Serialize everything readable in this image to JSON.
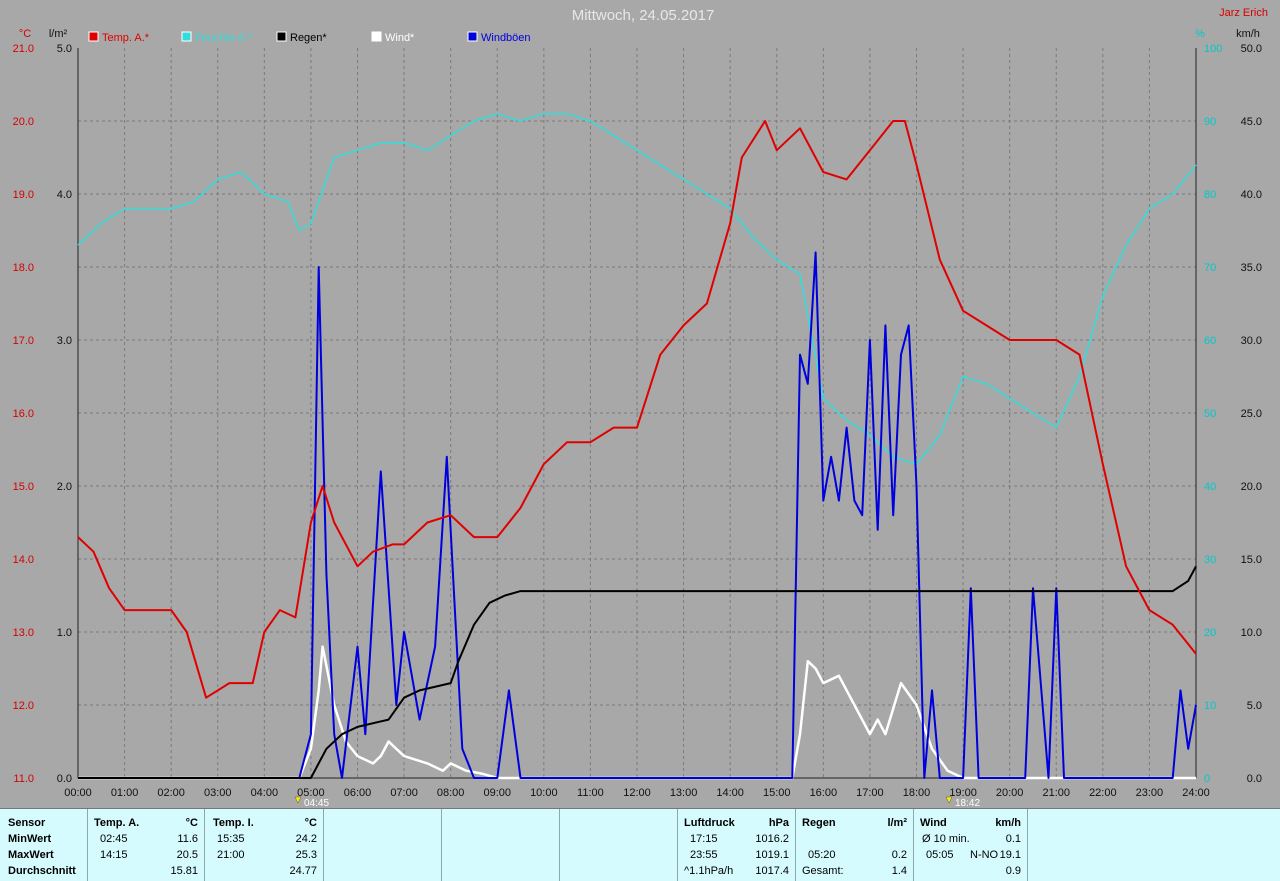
{
  "page": {
    "title": "Mittwoch, 24.05.2017",
    "author": "Jarz Erich",
    "marker_start": "04:45",
    "marker_end": "18:42"
  },
  "colors": {
    "background": "#a8a8a8",
    "plot_bg": "#a8a8a8",
    "temp": "#e00000",
    "humidity": "#33dddd",
    "rain": "#000000",
    "wind": "#ffffff",
    "gusts": "#0000dd",
    "panel": "#d6fbff"
  },
  "axes": {
    "left_temp": {
      "unit": "°C",
      "ticks": [
        "11.0",
        "12.0",
        "13.0",
        "14.0",
        "15.0",
        "16.0",
        "17.0",
        "18.0",
        "19.0",
        "20.0",
        "21.0"
      ]
    },
    "left_rain": {
      "unit": "l/m²",
      "ticks": [
        "0.0",
        "1.0",
        "2.0",
        "3.0",
        "4.0",
        "5.0"
      ]
    },
    "right_hum": {
      "unit": "%",
      "ticks": [
        "0",
        "10",
        "20",
        "30",
        "40",
        "50",
        "60",
        "70",
        "80",
        "90",
        "100"
      ]
    },
    "right_wind": {
      "unit": "km/h",
      "ticks": [
        "0.0",
        "5.0",
        "10.0",
        "15.0",
        "20.0",
        "25.0",
        "30.0",
        "35.0",
        "40.0",
        "45.0",
        "50.0"
      ]
    },
    "x_ticks": [
      "00:00",
      "01:00",
      "02:00",
      "03:00",
      "04:00",
      "05:00",
      "06:00",
      "07:00",
      "08:00",
      "09:00",
      "10:00",
      "11:00",
      "12:00",
      "13:00",
      "14:00",
      "15:00",
      "16:00",
      "17:00",
      "18:00",
      "19:00",
      "20:00",
      "21:00",
      "22:00",
      "23:00",
      "24:00"
    ]
  },
  "legend": [
    {
      "label": "Temp. A.*",
      "color": "#e00000"
    },
    {
      "label": "Feuchte A.*",
      "color": "#33dddd"
    },
    {
      "label": "Regen*",
      "color": "#000000"
    },
    {
      "label": "Wind*",
      "color": "#ffffff"
    },
    {
      "label": "Windböen",
      "color": "#0000dd"
    }
  ],
  "chart_data": {
    "type": "line",
    "x_range": [
      "00:00",
      "24:00"
    ],
    "grid": true,
    "legend_position": "top",
    "series": [
      {
        "name": "Temp. A.*",
        "axis": "left_temp",
        "unit": "°C",
        "x": [
          "00:00",
          "00:20",
          "00:40",
          "01:00",
          "01:30",
          "02:00",
          "02:20",
          "02:45",
          "03:15",
          "03:45",
          "04:00",
          "04:20",
          "04:40",
          "05:00",
          "05:15",
          "05:30",
          "06:00",
          "06:20",
          "06:45",
          "07:00",
          "07:30",
          "08:00",
          "08:30",
          "09:00",
          "09:30",
          "10:00",
          "10:30",
          "11:00",
          "11:30",
          "12:00",
          "12:30",
          "13:00",
          "13:30",
          "14:00",
          "14:15",
          "14:45",
          "15:00",
          "15:30",
          "16:00",
          "16:30",
          "17:00",
          "17:30",
          "17:45",
          "18:00",
          "18:30",
          "19:00",
          "19:30",
          "20:00",
          "20:30",
          "21:00",
          "21:30",
          "22:00",
          "22:30",
          "23:00",
          "23:30",
          "24:00"
        ],
        "values": [
          14.3,
          14.1,
          13.6,
          13.3,
          13.3,
          13.3,
          13.0,
          12.1,
          12.3,
          12.3,
          13.0,
          13.3,
          13.2,
          14.5,
          15.0,
          14.5,
          13.9,
          14.1,
          14.2,
          14.2,
          14.5,
          14.6,
          14.3,
          14.3,
          14.7,
          15.3,
          15.6,
          15.6,
          15.8,
          15.8,
          16.8,
          17.2,
          17.5,
          18.6,
          19.5,
          20.0,
          19.6,
          19.9,
          19.3,
          19.2,
          19.6,
          20.0,
          20.0,
          19.4,
          18.1,
          17.4,
          17.2,
          17.0,
          17.0,
          17.0,
          16.8,
          15.3,
          13.9,
          13.3,
          13.1,
          12.7
        ]
      },
      {
        "name": "Feuchte A.*",
        "axis": "right_hum",
        "unit": "%",
        "x": [
          "00:00",
          "00:30",
          "01:00",
          "01:30",
          "02:00",
          "02:30",
          "03:00",
          "03:30",
          "04:00",
          "04:30",
          "04:45",
          "05:00",
          "05:30",
          "06:00",
          "06:30",
          "07:00",
          "07:30",
          "08:00",
          "08:30",
          "09:00",
          "09:30",
          "10:00",
          "10:30",
          "11:00",
          "11:30",
          "12:00",
          "12:30",
          "13:00",
          "13:30",
          "14:00",
          "14:30",
          "15:00",
          "15:30",
          "16:00",
          "16:30",
          "17:00",
          "17:30",
          "18:00",
          "18:30",
          "19:00",
          "19:30",
          "20:00",
          "20:30",
          "21:00",
          "21:30",
          "22:00",
          "22:30",
          "23:00",
          "23:30",
          "24:00"
        ],
        "values": [
          73,
          76,
          78,
          78,
          78,
          79,
          82,
          83,
          80,
          79,
          75,
          76,
          85,
          86,
          87,
          87,
          86,
          88,
          90,
          91,
          90,
          91,
          91,
          90,
          88,
          86,
          84,
          82,
          80,
          78,
          74,
          71,
          69,
          52,
          49,
          47,
          44,
          43,
          47,
          55,
          54,
          52,
          50,
          48,
          55,
          66,
          73,
          78,
          80,
          84
        ]
      },
      {
        "name": "Regen*",
        "axis": "left_rain",
        "unit": "l/m²",
        "x": [
          "00:00",
          "05:00",
          "05:20",
          "05:40",
          "06:00",
          "06:40",
          "07:00",
          "07:20",
          "08:00",
          "08:10",
          "08:30",
          "08:50",
          "09:10",
          "09:30",
          "10:00",
          "23:20",
          "23:30",
          "23:50",
          "24:00"
        ],
        "values": [
          0.0,
          0.0,
          0.2,
          0.3,
          0.35,
          0.4,
          0.55,
          0.6,
          0.65,
          0.8,
          1.05,
          1.2,
          1.25,
          1.28,
          1.28,
          1.28,
          1.28,
          1.35,
          1.45
        ]
      },
      {
        "name": "Wind*",
        "axis": "right_wind",
        "unit": "km/h",
        "x": [
          "00:00",
          "04:45",
          "05:00",
          "05:10",
          "05:15",
          "05:30",
          "05:45",
          "06:00",
          "06:20",
          "06:30",
          "06:40",
          "06:50",
          "07:00",
          "07:30",
          "07:50",
          "08:00",
          "08:20",
          "08:40",
          "09:00",
          "15:20",
          "15:30",
          "15:40",
          "15:50",
          "16:00",
          "16:20",
          "16:40",
          "17:00",
          "17:10",
          "17:20",
          "17:40",
          "18:00",
          "18:20",
          "18:40",
          "19:00",
          "24:00"
        ],
        "values": [
          0.0,
          0.0,
          2.0,
          6.0,
          9.0,
          5.0,
          2.5,
          1.5,
          1.0,
          1.5,
          2.5,
          2.0,
          1.5,
          1.0,
          0.5,
          1.0,
          0.5,
          0.3,
          0.0,
          0.0,
          3.0,
          8.0,
          7.5,
          6.5,
          7.0,
          5.0,
          3.0,
          4.0,
          3.0,
          6.5,
          5.0,
          2.0,
          0.5,
          0.0,
          0.0
        ]
      },
      {
        "name": "Windböen",
        "axis": "right_wind",
        "unit": "km/h",
        "x": [
          "00:00",
          "04:45",
          "05:00",
          "05:10",
          "05:20",
          "05:30",
          "05:40",
          "06:00",
          "06:10",
          "06:30",
          "06:40",
          "06:50",
          "07:00",
          "07:20",
          "07:40",
          "07:55",
          "08:05",
          "08:15",
          "08:30",
          "09:00",
          "09:15",
          "09:30",
          "15:20",
          "15:30",
          "15:40",
          "15:50",
          "16:00",
          "16:10",
          "16:20",
          "16:30",
          "16:40",
          "16:50",
          "17:00",
          "17:10",
          "17:20",
          "17:30",
          "17:40",
          "17:50",
          "18:00",
          "18:10",
          "18:20",
          "18:30",
          "19:00",
          "19:10",
          "19:20",
          "20:20",
          "20:30",
          "20:50",
          "21:00",
          "21:10",
          "23:30",
          "23:40",
          "23:50",
          "24:00"
        ],
        "values": [
          0,
          0,
          3,
          35,
          14,
          3,
          0,
          9,
          3,
          21,
          13,
          5,
          10,
          4,
          9,
          22,
          12,
          2,
          0,
          0,
          6,
          0,
          0,
          29,
          27,
          36,
          19,
          22,
          19,
          24,
          19,
          18,
          30,
          17,
          31,
          18,
          29,
          31,
          20,
          0,
          6,
          0,
          0,
          13,
          0,
          0,
          13,
          0,
          13,
          0,
          0,
          6,
          2,
          5
        ]
      }
    ]
  },
  "stats": {
    "sensor": {
      "header": "Sensor",
      "rows": [
        "MinWert",
        "MaxWert",
        "Durchschnitt"
      ]
    },
    "temp_a": {
      "header": "Temp. A.",
      "unit": "°C",
      "min": {
        "time": "02:45",
        "value": "11.6"
      },
      "max": {
        "time": "14:15",
        "value": "20.5"
      },
      "avg": "15.81"
    },
    "temp_i": {
      "header": "Temp. I.",
      "unit": "°C",
      "min": {
        "time": "15:35",
        "value": "24.2"
      },
      "max": {
        "time": "21:00",
        "value": "25.3"
      },
      "avg": "24.77"
    },
    "luftdruck": {
      "header": "Luftdruck",
      "unit": "hPa",
      "min": {
        "time": "17:15",
        "value": "1016.2"
      },
      "max": {
        "time": "23:55",
        "value": "1019.1"
      },
      "avg": {
        "label": "^1.1hPa/h",
        "value": "1017.4"
      }
    },
    "regen": {
      "header": "Regen",
      "unit": "l/m²",
      "max": {
        "time": "05:20",
        "value": "0.2"
      },
      "total": {
        "label": "Gesamt:",
        "value": "1.4"
      }
    },
    "wind": {
      "header": "Wind",
      "unit": "km/h",
      "min": {
        "label": "Ø 10 min.",
        "value": "0.1"
      },
      "max": {
        "time": "05:05",
        "dir": "N-NO",
        "value": "19.1"
      },
      "avg": "0.9"
    }
  }
}
